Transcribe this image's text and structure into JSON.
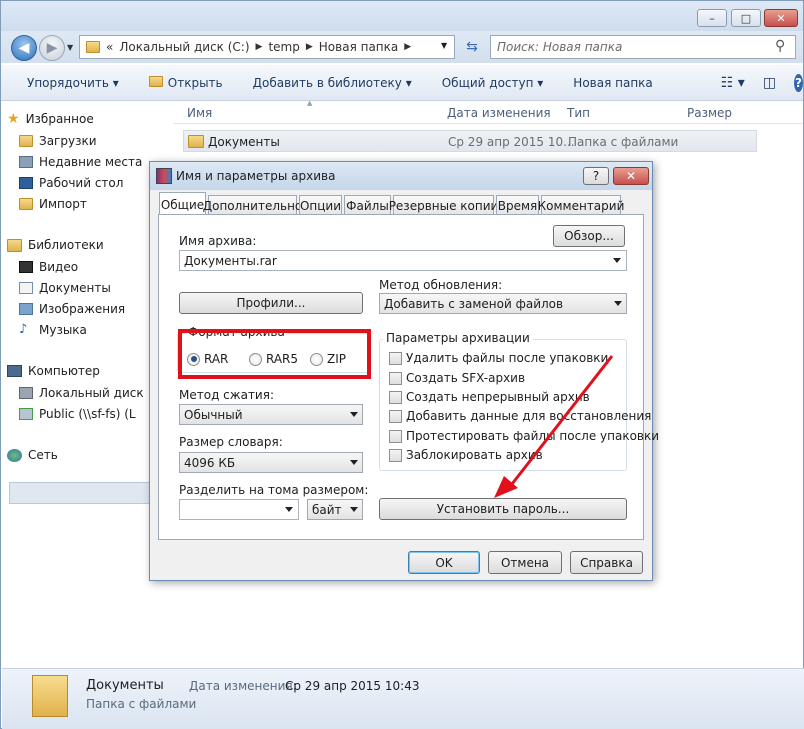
{
  "explorer": {
    "caption_buttons": {
      "minimize": "–",
      "maximize": "□",
      "close": "✕"
    },
    "breadcrumb": {
      "prefix": "«",
      "parts": [
        "Локальный диск (C:)",
        "temp",
        "Новая папка"
      ]
    },
    "search_placeholder": "Поиск: Новая папка",
    "toolbar": {
      "organize": "Упорядочить",
      "open": "Открыть",
      "add_to_library": "Добавить в библиотеку",
      "share": "Общий доступ",
      "new_folder": "Новая папка"
    },
    "sidebar": {
      "favorites_title": "Избранное",
      "favorites": [
        "Загрузки",
        "Недавние места",
        "Рабочий стол",
        "Импорт"
      ],
      "libraries_title": "Библиотеки",
      "libraries": [
        "Видео",
        "Документы",
        "Изображения",
        "Музыка"
      ],
      "computer_title": "Компьютер",
      "computer": [
        "Локальный диск",
        "Public (\\\\sf-fs) (L"
      ],
      "network_title": "Сеть"
    },
    "columns": {
      "name": "Имя",
      "date": "Дата изменения",
      "type": "Тип",
      "size": "Размер"
    },
    "rows": [
      {
        "name": "Документы",
        "date": "Ср 29 апр 2015 10...",
        "type": "Папка с файлами"
      }
    ],
    "details": {
      "name": "Документы",
      "type": "Папка с файлами",
      "date_label": "Дата изменения:",
      "date_value": "Ср 29 апр 2015 10:43"
    }
  },
  "dialog": {
    "title": "Имя и параметры архива",
    "help_button": "?",
    "close_button": "✕",
    "tabs": [
      "Общие",
      "Дополнительно",
      "Опции",
      "Файлы",
      "Резервные копии",
      "Время",
      "Комментарий"
    ],
    "active_tab": "Общие",
    "archive_name_label": "Имя архива:",
    "archive_name_value": "Документы.rar",
    "browse_button": "Обзор...",
    "update_method_label": "Метод обновления:",
    "update_method_value": "Добавить с заменой файлов",
    "profiles_button": "Профили...",
    "format_group": "Формат архива",
    "formats": [
      {
        "label": "RAR",
        "selected": true
      },
      {
        "label": "RAR5",
        "selected": false
      },
      {
        "label": "ZIP",
        "selected": false
      }
    ],
    "compression_label": "Метод сжатия:",
    "compression_value": "Обычный",
    "dictionary_label": "Размер словаря:",
    "dictionary_value": "4096 КБ",
    "split_label": "Разделить на тома размером:",
    "split_value": "",
    "split_unit": "байт",
    "options_group": "Параметры архивации",
    "options": [
      "Удалить файлы после упаковки",
      "Создать SFX-архив",
      "Создать непрерывный архив",
      "Добавить данные для восстановления",
      "Протестировать файлы после упаковки",
      "Заблокировать архив"
    ],
    "set_password_button": "Установить пароль...",
    "ok_button": "OK",
    "cancel_button": "Отмена",
    "help_btn_label": "Справка"
  },
  "annotations": {
    "highlight_color": "#e0111b",
    "arrow_color": "#e0111b"
  }
}
